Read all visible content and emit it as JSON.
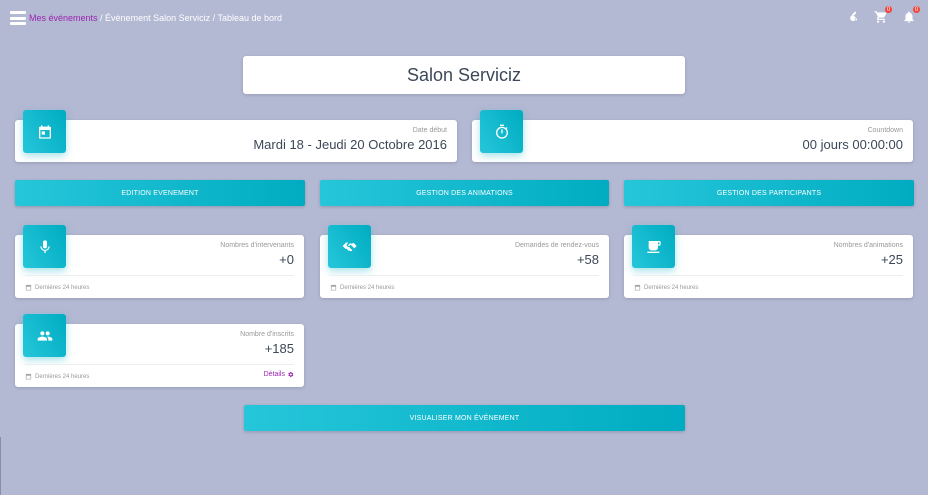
{
  "breadcrumb": {
    "link": "Mes événements",
    "rest": " / Évènement Salon Serviciz / Tableau de bord"
  },
  "topbar": {
    "icons": [
      "menu-icon",
      "key-icon",
      "cart-icon",
      "bell-icon"
    ],
    "cart_badge": "0",
    "notification_badge": "0"
  },
  "title": "Salon Serviciz",
  "date_card": {
    "icon": "calendar-icon",
    "category": "Date début",
    "value": "Mardi 18 - Jeudi 20 Octobre 2016"
  },
  "countdown_card": {
    "icon": "timer-icon",
    "category": "Countdown",
    "value": "00 jours 00:00:00"
  },
  "buttons": {
    "edit_event": "EDITION EVENEMENT",
    "animations": "GESTION DES ANIMATIONS",
    "participants": "GESTION DES PARTICIPANTS",
    "view_event": "VISUALISER MON ÉVÉNEMENT"
  },
  "stats": [
    {
      "icon": "microphone-icon",
      "category": "Nombres d'intervenants",
      "value": "+0",
      "footer": "Dernières 24 heures"
    },
    {
      "icon": "handshake-icon",
      "category": "Demandes de rendez-vous",
      "value": "+58",
      "footer": "Dernières 24 heures"
    },
    {
      "icon": "coffee-icon",
      "category": "Nombres d'animations",
      "value": "+25",
      "footer": "Dernières 24 heures"
    },
    {
      "icon": "people-icon",
      "category": "Nombre d'inscrits",
      "value": "+185",
      "footer": "Dernières 24 heures",
      "details": "Détails"
    }
  ],
  "colors": {
    "background": "#b3b8d3",
    "accent": "#00acc1",
    "link": "#9c27b0",
    "badge": "#f44336"
  }
}
